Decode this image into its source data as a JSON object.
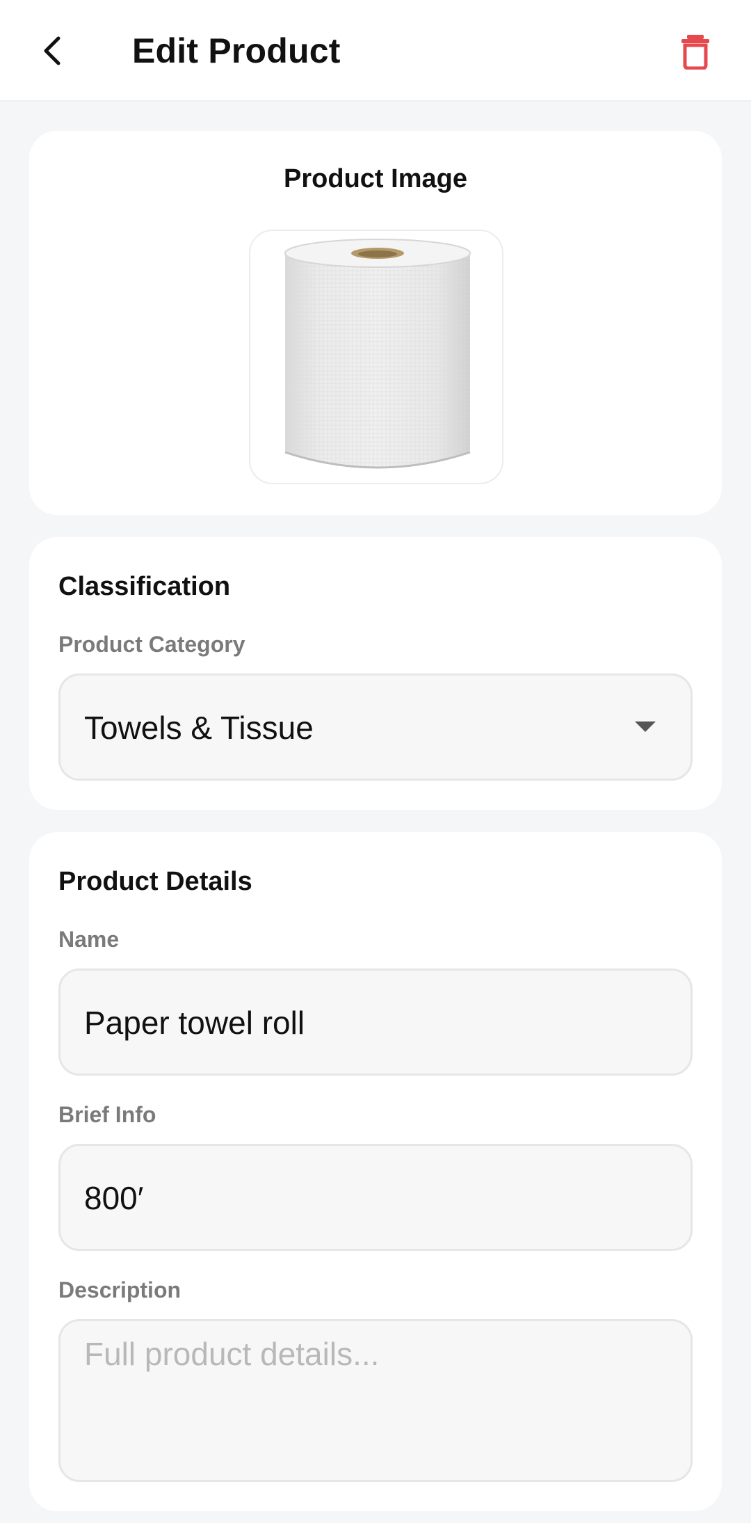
{
  "header": {
    "title": "Edit Product",
    "back_icon": "chevron-left-icon",
    "delete_icon": "trash-icon",
    "delete_color": "#e5484d"
  },
  "image_section": {
    "title": "Product Image"
  },
  "classification": {
    "title": "Classification",
    "category_label": "Product Category",
    "category_value": "Towels & Tissue"
  },
  "details": {
    "title": "Product Details",
    "name_label": "Name",
    "name_value": "Paper towel roll",
    "brief_label": "Brief Info",
    "brief_value": "800′",
    "description_label": "Description",
    "description_placeholder": "Full product details..."
  }
}
